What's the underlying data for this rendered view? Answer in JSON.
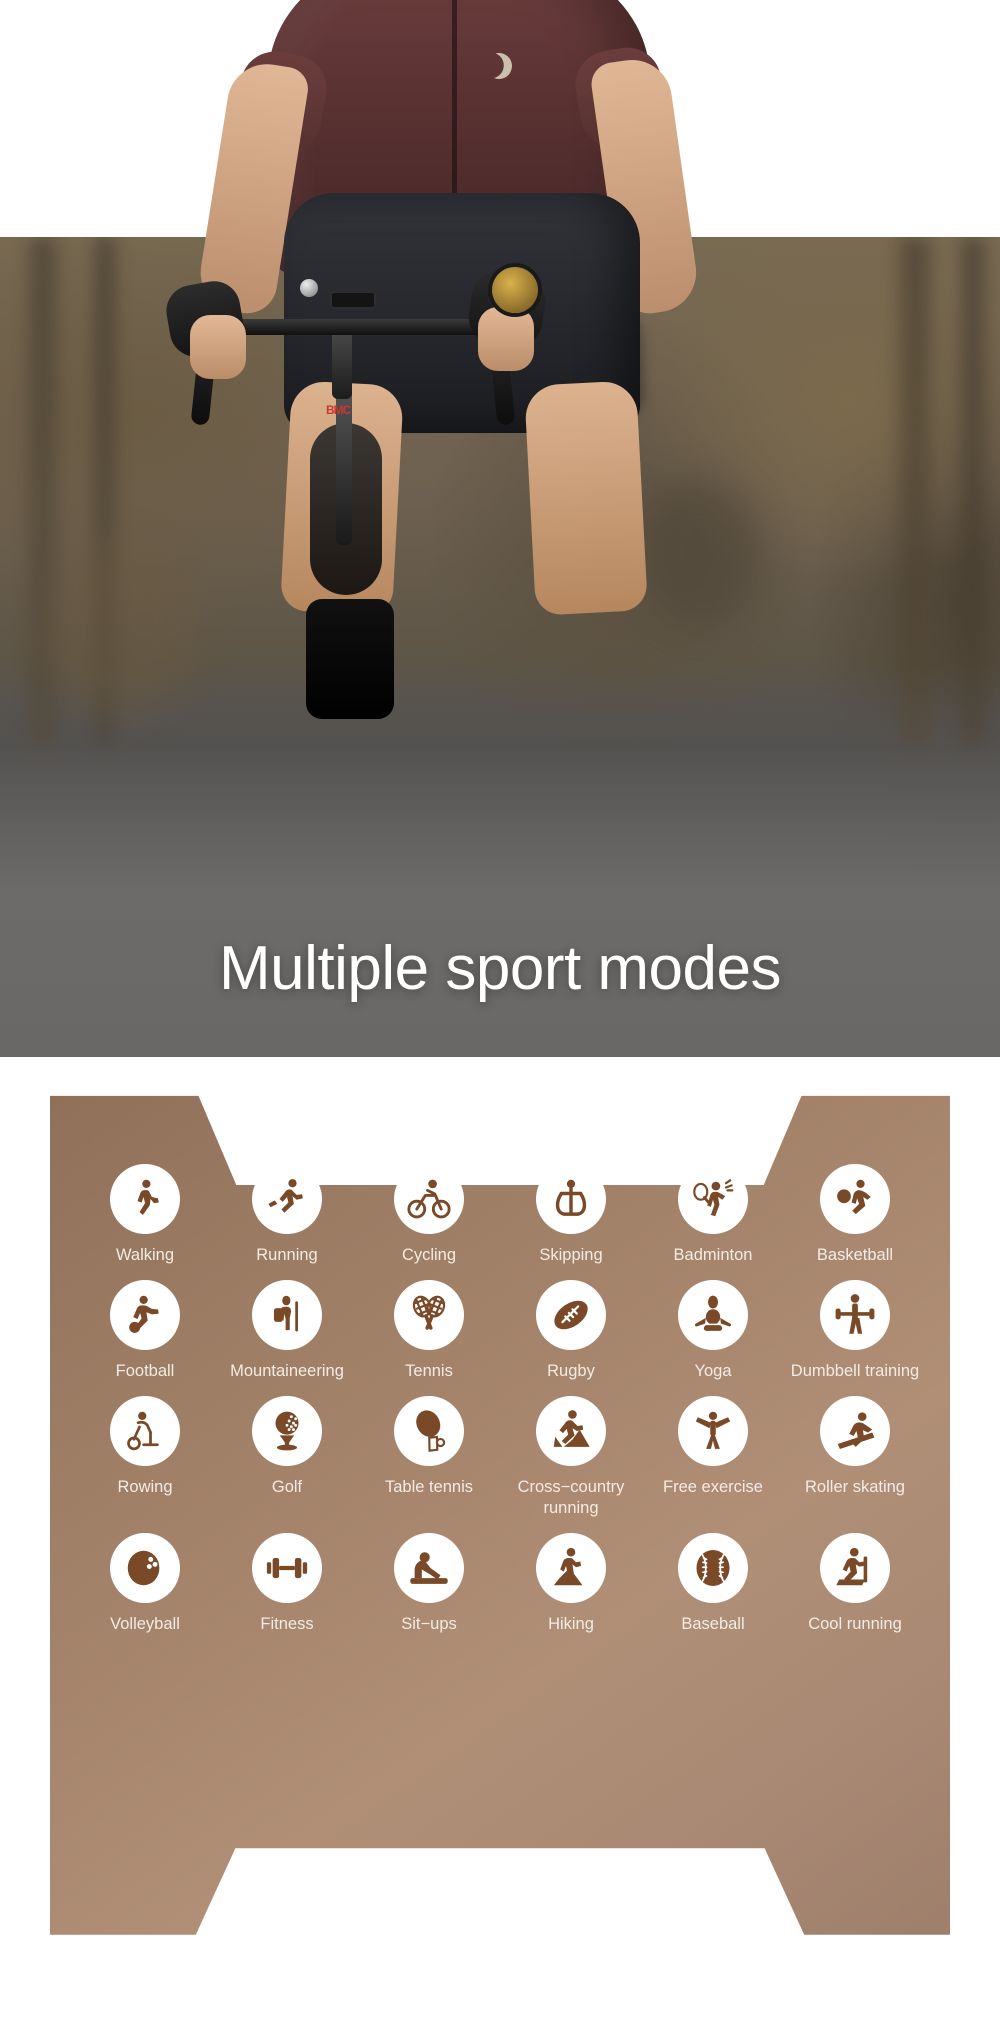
{
  "page": {
    "headline": "Multiple sport modes",
    "panel_color": "#a7866d",
    "icon_circle_color": "#ffffff",
    "icon_glyph_color": "#7a4a28",
    "label_color": "#f3ece6",
    "headline_color": "#ffffff"
  },
  "hero": {
    "scene": "cyclist-photo",
    "alt_subject": "male cyclist on road bike"
  },
  "sport_modes": {
    "rows": [
      [
        {
          "label": "Walking",
          "icon": "walking-icon"
        },
        {
          "label": "Running",
          "icon": "running-icon"
        },
        {
          "label": "Cycling",
          "icon": "cycling-icon"
        },
        {
          "label": "Skipping",
          "icon": "skipping-rope-icon"
        },
        {
          "label": "Badminton",
          "icon": "badminton-icon"
        },
        {
          "label": "Basketball",
          "icon": "basketball-icon"
        }
      ],
      [
        {
          "label": "Football",
          "icon": "football-icon"
        },
        {
          "label": "Mountaineering",
          "icon": "mountaineering-icon"
        },
        {
          "label": "Tennis",
          "icon": "tennis-icon"
        },
        {
          "label": "Rugby",
          "icon": "rugby-icon"
        },
        {
          "label": "Yoga",
          "icon": "yoga-icon"
        },
        {
          "label": "Dumbbell training",
          "icon": "dumbbell-training-icon"
        }
      ],
      [
        {
          "label": "Rowing",
          "icon": "rowing-icon"
        },
        {
          "label": "Golf",
          "icon": "golf-icon"
        },
        {
          "label": "Table tennis",
          "icon": "table-tennis-icon"
        },
        {
          "label": "Cross−country running",
          "icon": "cross-country-running-icon"
        },
        {
          "label": "Free exercise",
          "icon": "free-exercise-icon"
        },
        {
          "label": "Roller skating",
          "icon": "roller-skating-icon"
        }
      ],
      [
        {
          "label": "Volleyball",
          "icon": "volleyball-icon"
        },
        {
          "label": "Fitness",
          "icon": "fitness-icon"
        },
        {
          "label": "Sit−ups",
          "icon": "sit-ups-icon"
        },
        {
          "label": "Hiking",
          "icon": "hiking-icon"
        },
        {
          "label": "Baseball",
          "icon": "baseball-icon"
        },
        {
          "label": "Cool running",
          "icon": "cool-running-icon"
        }
      ]
    ]
  }
}
